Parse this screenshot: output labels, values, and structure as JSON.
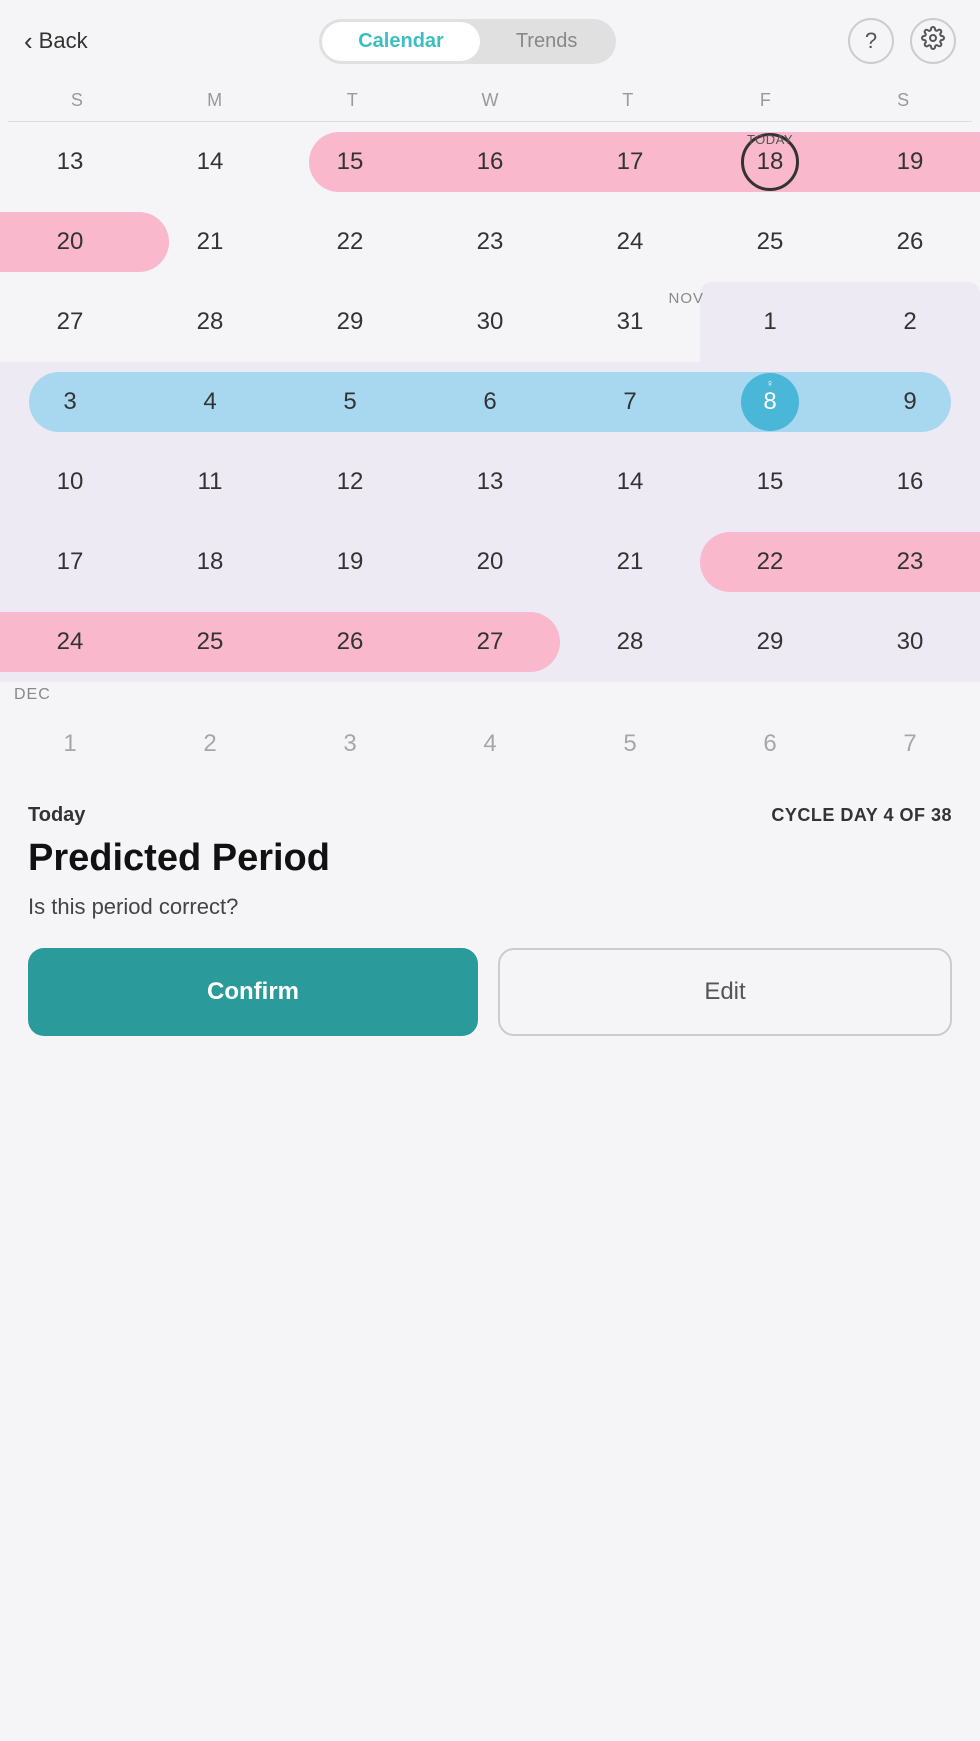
{
  "header": {
    "back_label": "Back",
    "toggle_calendar": "Calendar",
    "toggle_trends": "Trends",
    "active_tab": "Calendar"
  },
  "icons": {
    "help": "?",
    "settings": "⚙"
  },
  "calendar": {
    "day_headers": [
      "S",
      "M",
      "T",
      "W",
      "T",
      "F",
      "S"
    ],
    "today_label": "TODAY",
    "nov_label": "NOV",
    "dec_label": "DEC",
    "weeks": [
      {
        "id": "oct-week1",
        "days": [
          13,
          14,
          15,
          16,
          17,
          18,
          19
        ],
        "pink_range": [
          15,
          19
        ],
        "today_index": 5,
        "note": "Oct row with pink 15-19, today=18"
      },
      {
        "id": "oct-week2",
        "days": [
          20,
          21,
          22,
          23,
          24,
          25,
          26
        ],
        "pink_range": [
          20,
          20
        ],
        "note": "Oct row, pink only day 20"
      },
      {
        "id": "oct-nov-week",
        "days": [
          27,
          28,
          29,
          30,
          31,
          "1",
          "2"
        ],
        "nov_start": 5,
        "note": "Oct 27-31 then Nov 1-2, light purple bg"
      },
      {
        "id": "nov-week1",
        "days": [
          3,
          4,
          5,
          6,
          7,
          8,
          9
        ],
        "blue_range": [
          3,
          9
        ],
        "ovulation_index": 5,
        "note": "Nov blue fertility week, ovulation on 8"
      },
      {
        "id": "nov-week2",
        "days": [
          10,
          11,
          12,
          13,
          14,
          15,
          16
        ],
        "note": "Nov plain week"
      },
      {
        "id": "nov-week3",
        "days": [
          17,
          18,
          19,
          20,
          21,
          22,
          23
        ],
        "pink_range": [
          22,
          23
        ],
        "note": "Nov week, pink on 22-23"
      },
      {
        "id": "nov-week4",
        "days": [
          24,
          25,
          26,
          27,
          28,
          29,
          30
        ],
        "pink_range": [
          24,
          27
        ],
        "note": "Nov week, pink on 24-27"
      }
    ]
  },
  "bottom": {
    "today_label": "Today",
    "cycle_label": "CYCLE DAY 4 OF 38",
    "title": "Predicted Period",
    "question": "Is this period correct?",
    "confirm_label": "Confirm",
    "edit_label": "Edit"
  }
}
